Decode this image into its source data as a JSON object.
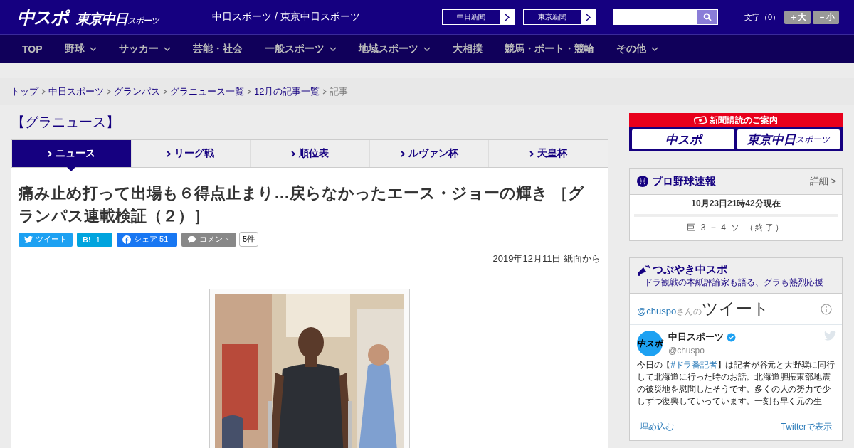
{
  "header": {
    "logo": "中スポ",
    "logo2": "東京中日",
    "logo2_small": "スポーツ",
    "site_title": "中日スポーツ / 東京中日スポーツ",
    "paper_links": [
      "中日新聞",
      "東京新聞"
    ],
    "font_label": "文字（0）",
    "font_buttons": [
      "＋大",
      "－小"
    ]
  },
  "nav": [
    {
      "label": "TOP",
      "dropdown": false
    },
    {
      "label": "野球",
      "dropdown": true
    },
    {
      "label": "サッカー",
      "dropdown": true
    },
    {
      "label": "芸能・社会",
      "dropdown": false
    },
    {
      "label": "一般スポーツ",
      "dropdown": true
    },
    {
      "label": "地域スポーツ",
      "dropdown": true
    },
    {
      "label": "大相撲",
      "dropdown": false
    },
    {
      "label": "競馬・ボート・競輪",
      "dropdown": false
    },
    {
      "label": "その他",
      "dropdown": true
    }
  ],
  "breadcrumb": [
    {
      "label": "トップ",
      "link": true
    },
    {
      "label": "中日スポーツ",
      "link": true
    },
    {
      "label": "グランパス",
      "link": true
    },
    {
      "label": "グラニュース一覧",
      "link": true
    },
    {
      "label": "12月の記事一覧",
      "link": true
    },
    {
      "label": "記事",
      "link": false
    }
  ],
  "section_title": "【グラニュース】",
  "tabs": [
    {
      "label": "ニュース",
      "selected": true
    },
    {
      "label": "リーグ戦",
      "selected": false
    },
    {
      "label": "順位表",
      "selected": false
    },
    {
      "label": "ルヴァン杯",
      "selected": false
    },
    {
      "label": "天皇杯",
      "selected": false
    }
  ],
  "article": {
    "title": "痛み止め打って出場も６得点止まり…戻らなかったエース・ジョーの輝き ［グランパス連載検証（２）］",
    "share": [
      {
        "kind": "tweet",
        "label": "ツイート"
      },
      {
        "kind": "hatena",
        "label": "B!",
        "count": "1"
      },
      {
        "kind": "facebook",
        "label": "シェア",
        "count": "51"
      },
      {
        "kind": "comment",
        "label": "コメント",
        "count": "5件"
      }
    ],
    "date": "2019年12月11日 紙面から"
  },
  "sidebar": {
    "subscribe": {
      "title": "新聞購読のご案内",
      "logos": [
        "中スポ",
        "東京中日"
      ],
      "logo_small": "スポーツ"
    },
    "baseball": {
      "title": "プロ野球速報",
      "more": "詳細 >",
      "time": "10月23日21時42分現在",
      "score": "巨 3 − 4 ソ （終了）"
    },
    "tweets": {
      "title": "つぶやき中スポ",
      "subtitle": "ドラ観戦の本紙評論家も語る、グラも熱烈応援",
      "handle": "@chuspo",
      "handle_suffix": "さんの",
      "heading": "ツイート",
      "account": "中日スポーツ",
      "account_handle": "@chuspo",
      "avatar_text": "中スポ",
      "tweet_before": "今日の【",
      "hashtag": "#ドラ番記者",
      "tweet_after": "】は記者が谷元と大野奨に同行して北海道に行った時のお話。北海道胆振東部地震の被災地を慰問したそうです。多くの人の努力で少しずつ復興していっています。一刻も早く元の生",
      "embed": "埋め込む",
      "view": "Twitterで表示"
    }
  }
}
